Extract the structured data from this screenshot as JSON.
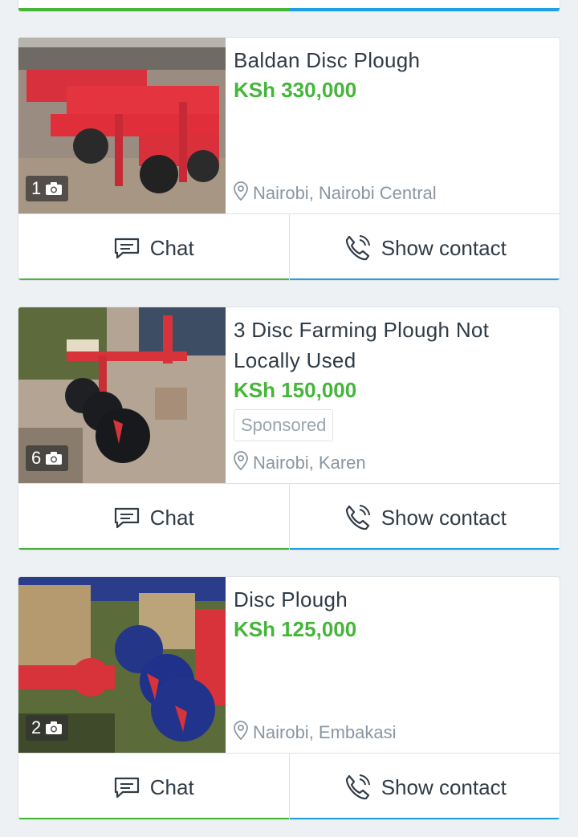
{
  "colors": {
    "price": "#46b53a",
    "chat_bar": "#47b536",
    "contact_bar": "#1da1e2"
  },
  "listings": [
    {
      "title": "Baldan Disc Plough",
      "price": "KSh 330,000",
      "location": "Nairobi, Nairobi Central",
      "photo_count": "1",
      "chat_label": "Chat",
      "contact_label": "Show contact"
    },
    {
      "title": "3 Disc Farming Plough Not Locally Used",
      "price": "KSh 150,000",
      "sponsored": "Sponsored",
      "location": "Nairobi, Karen",
      "photo_count": "6",
      "chat_label": "Chat",
      "contact_label": "Show contact"
    },
    {
      "title": "Disc Plough",
      "price": "KSh 125,000",
      "location": "Nairobi, Embakasi",
      "photo_count": "2",
      "chat_label": "Chat",
      "contact_label": "Show contact"
    }
  ]
}
